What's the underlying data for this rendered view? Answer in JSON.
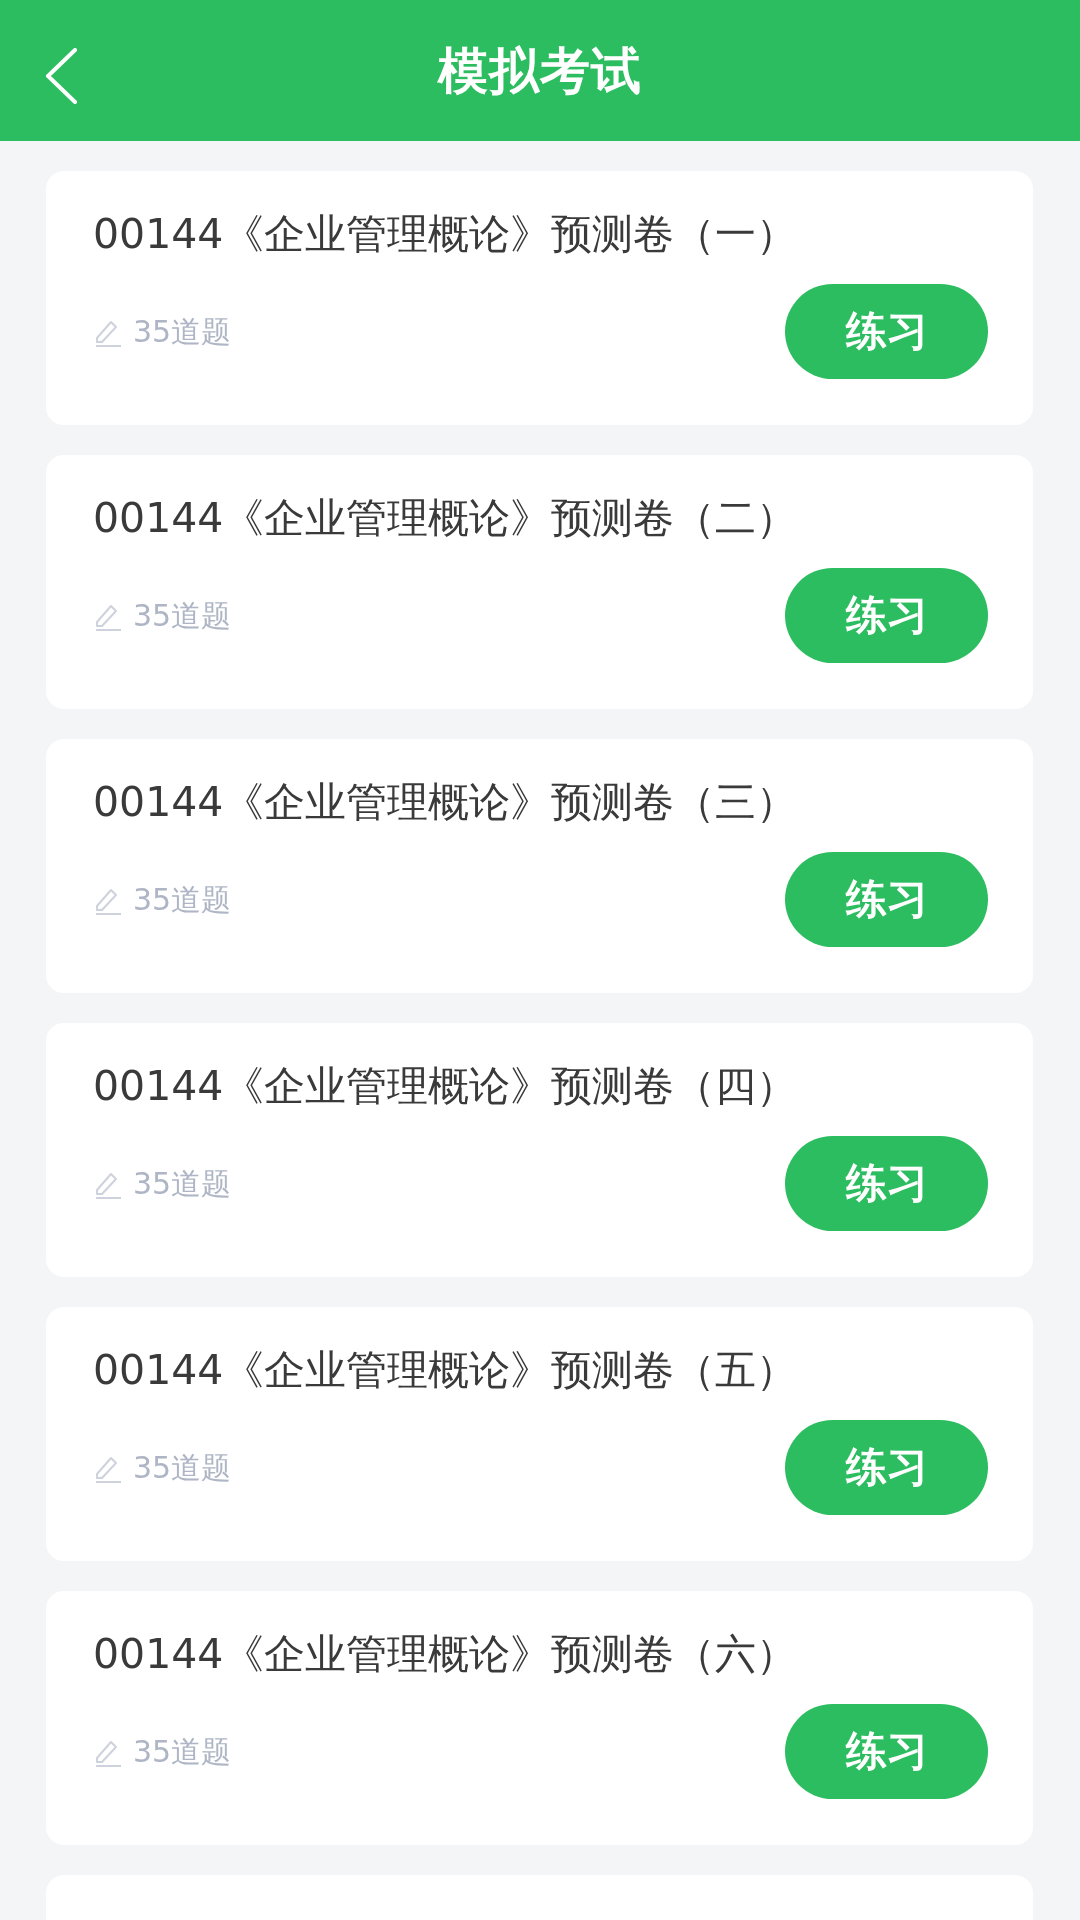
{
  "header": {
    "title": "模拟考试"
  },
  "papers": [
    {
      "title": "00144《企业管理概论》预测卷（一）",
      "question_count": "35道题",
      "button": "练习"
    },
    {
      "title": "00144《企业管理概论》预测卷（二）",
      "question_count": "35道题",
      "button": "练习"
    },
    {
      "title": "00144《企业管理概论》预测卷（三）",
      "question_count": "35道题",
      "button": "练习"
    },
    {
      "title": "00144《企业管理概论》预测卷（四）",
      "question_count": "35道题",
      "button": "练习"
    },
    {
      "title": "00144《企业管理概论》预测卷（五）",
      "question_count": "35道题",
      "button": "练习"
    },
    {
      "title": "00144《企业管理概论》预测卷（六）",
      "question_count": "35道题",
      "button": "练习"
    }
  ]
}
